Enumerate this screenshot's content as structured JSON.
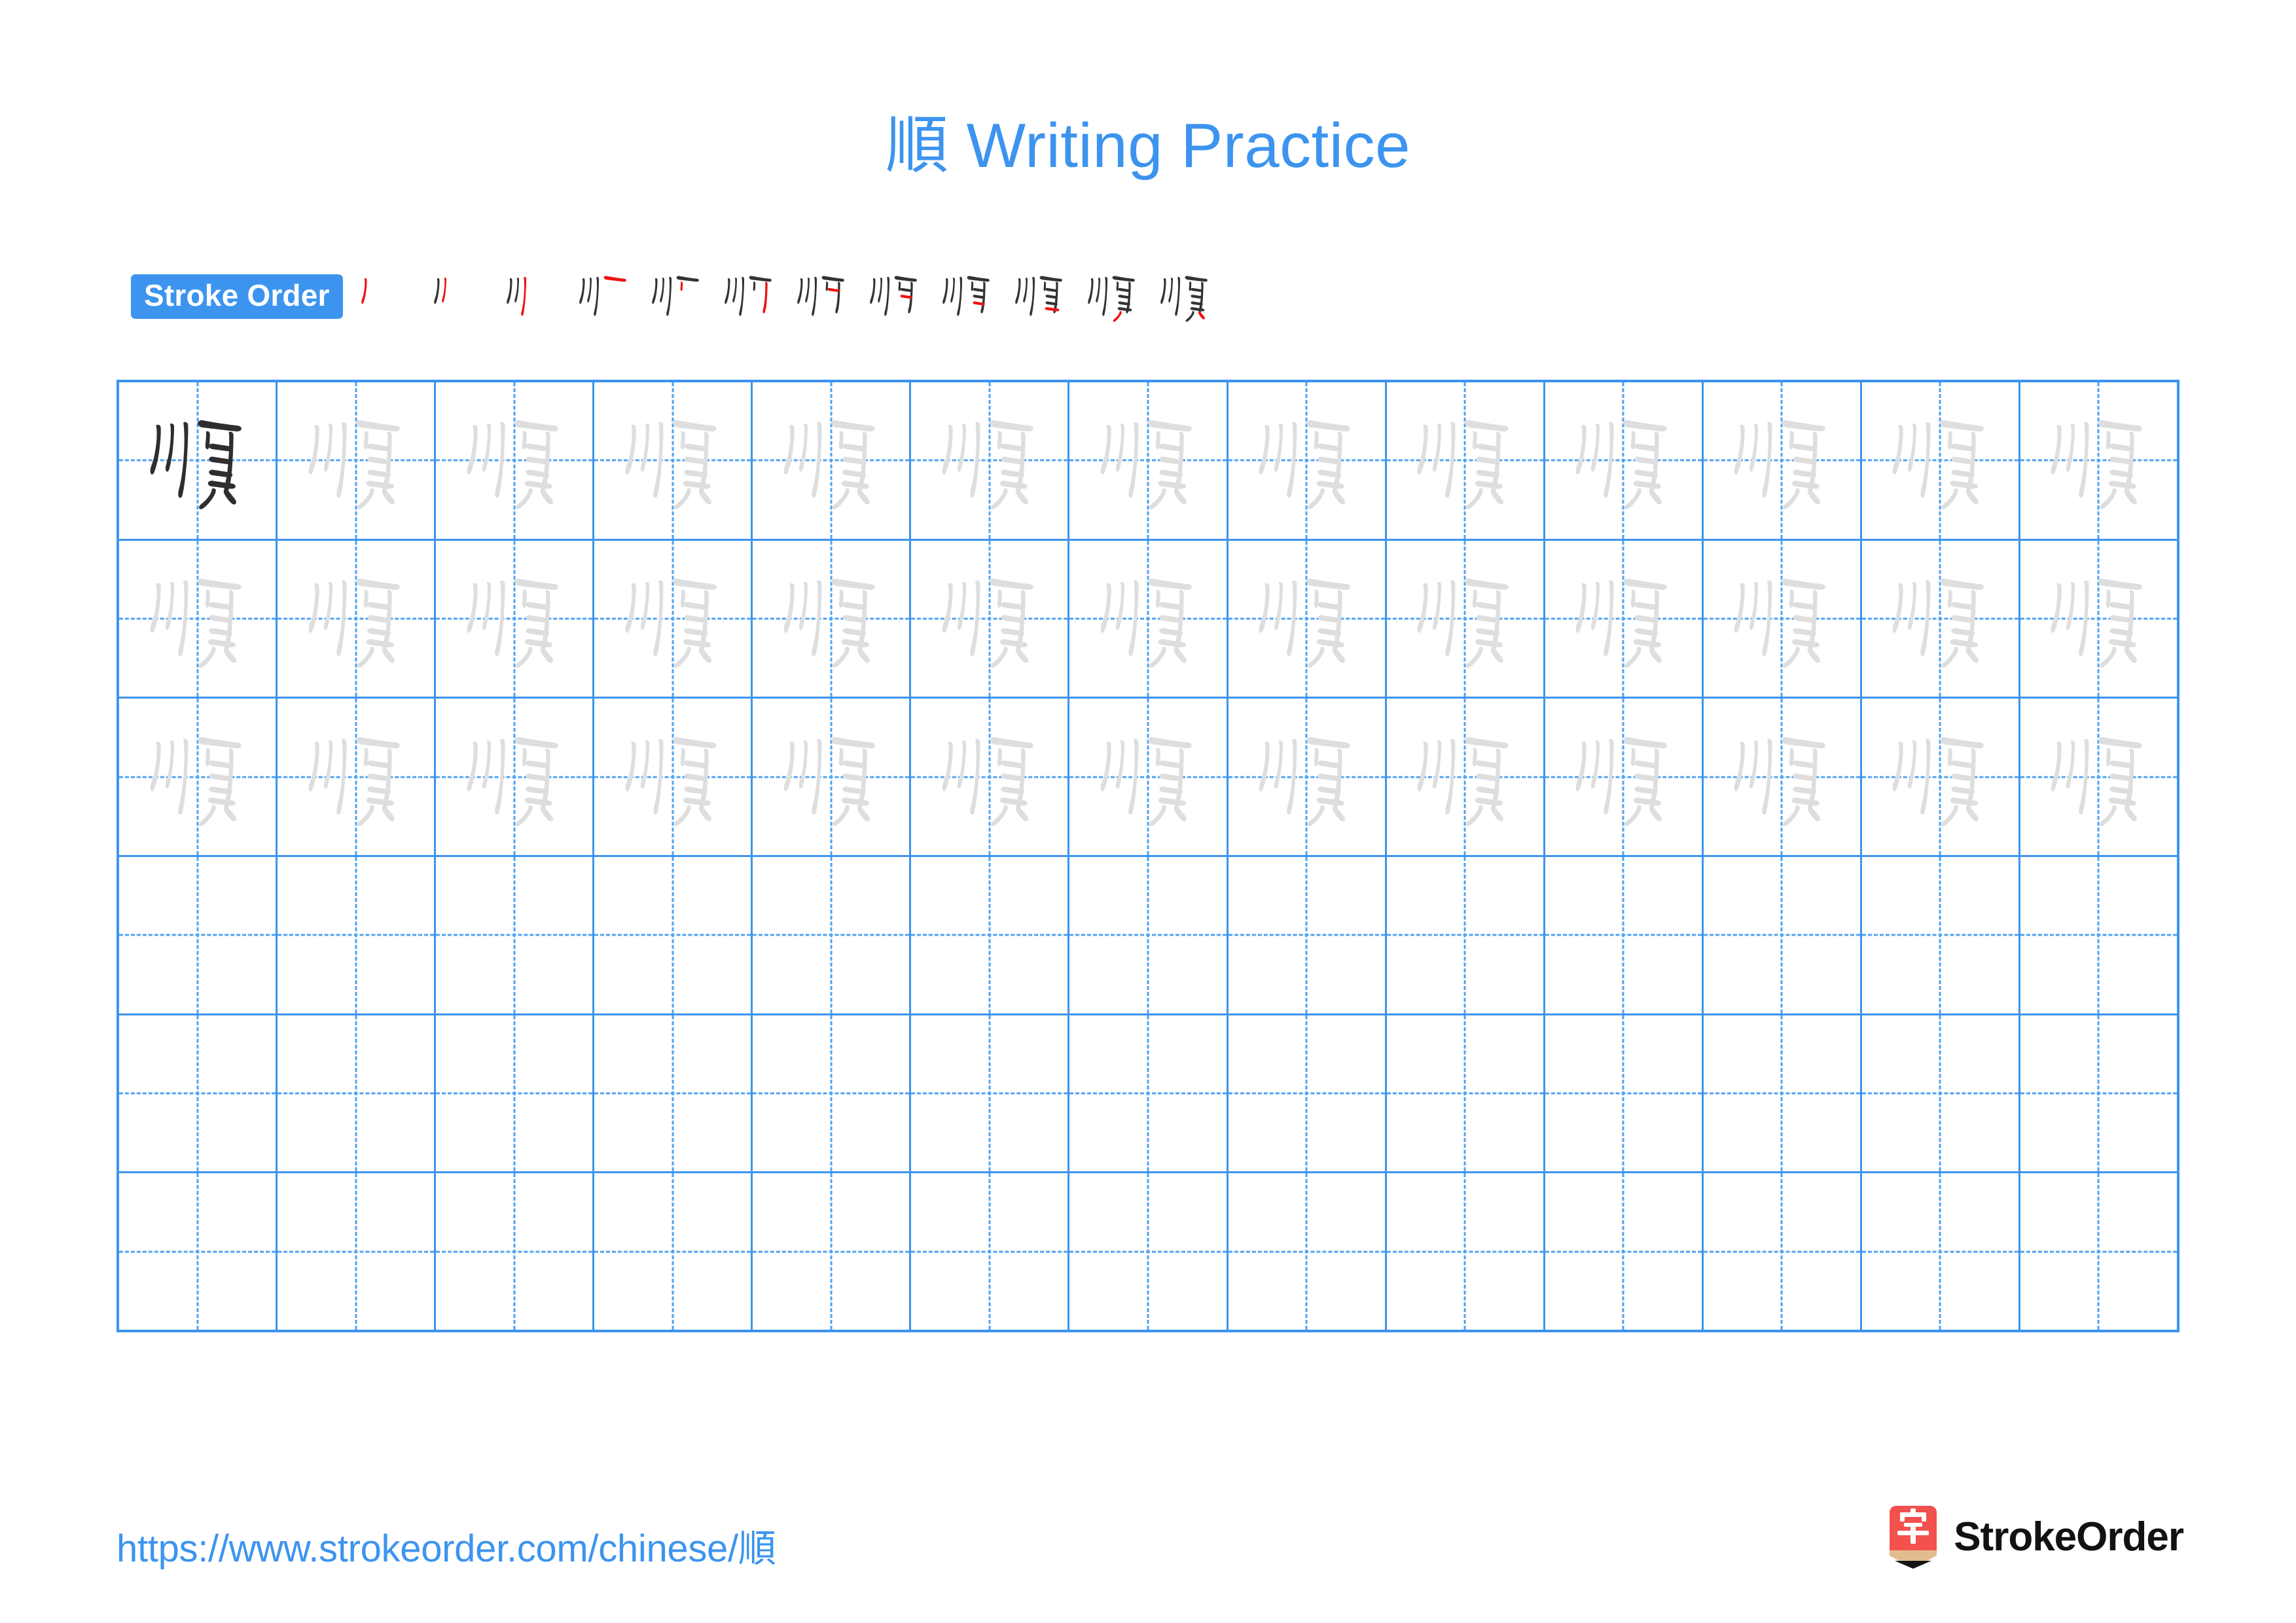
{
  "page": {
    "title": "順 Writing Practice",
    "character": "順",
    "character_color_dark": "#2e2e2e",
    "character_color_light": "#dedede",
    "accent_color": "#3c94ef",
    "stroke_highlight_color": "#ee1111",
    "grid_line_color": "#3c94ef",
    "grid_guide_color": "#4fa3f2"
  },
  "stroke_order": {
    "badge_label": "Stroke Order",
    "stroke_count": 12,
    "steps": [
      {
        "index": 1,
        "strokes_drawn": 1,
        "new_stroke": 1
      },
      {
        "index": 2,
        "strokes_drawn": 2,
        "new_stroke": 2
      },
      {
        "index": 3,
        "strokes_drawn": 3,
        "new_stroke": 3
      },
      {
        "index": 4,
        "strokes_drawn": 4,
        "new_stroke": 4
      },
      {
        "index": 5,
        "strokes_drawn": 5,
        "new_stroke": 5
      },
      {
        "index": 6,
        "strokes_drawn": 6,
        "new_stroke": 6
      },
      {
        "index": 7,
        "strokes_drawn": 7,
        "new_stroke": 7
      },
      {
        "index": 8,
        "strokes_drawn": 8,
        "new_stroke": 8
      },
      {
        "index": 9,
        "strokes_drawn": 9,
        "new_stroke": 9
      },
      {
        "index": 10,
        "strokes_drawn": 10,
        "new_stroke": 10
      },
      {
        "index": 11,
        "strokes_drawn": 11,
        "new_stroke": 11
      },
      {
        "index": 12,
        "strokes_drawn": 12,
        "new_stroke": 12
      }
    ]
  },
  "practice_grid": {
    "columns": 13,
    "rows": 6,
    "rows_data": [
      {
        "row": 1,
        "cells": [
          "dark",
          "light",
          "light",
          "light",
          "light",
          "light",
          "light",
          "light",
          "light",
          "light",
          "light",
          "light",
          "light"
        ]
      },
      {
        "row": 2,
        "cells": [
          "light",
          "light",
          "light",
          "light",
          "light",
          "light",
          "light",
          "light",
          "light",
          "light",
          "light",
          "light",
          "light"
        ]
      },
      {
        "row": 3,
        "cells": [
          "light",
          "light",
          "light",
          "light",
          "light",
          "light",
          "light",
          "light",
          "light",
          "light",
          "light",
          "light",
          "light"
        ]
      },
      {
        "row": 4,
        "cells": [
          "empty",
          "empty",
          "empty",
          "empty",
          "empty",
          "empty",
          "empty",
          "empty",
          "empty",
          "empty",
          "empty",
          "empty",
          "empty"
        ]
      },
      {
        "row": 5,
        "cells": [
          "empty",
          "empty",
          "empty",
          "empty",
          "empty",
          "empty",
          "empty",
          "empty",
          "empty",
          "empty",
          "empty",
          "empty",
          "empty"
        ]
      },
      {
        "row": 6,
        "cells": [
          "empty",
          "empty",
          "empty",
          "empty",
          "empty",
          "empty",
          "empty",
          "empty",
          "empty",
          "empty",
          "empty",
          "empty",
          "empty"
        ]
      }
    ]
  },
  "footer": {
    "url": "https://www.strokeorder.com/chinese/順",
    "logo_text": "StrokeOrder",
    "logo_glyph": "字",
    "logo_color": "#f2514e",
    "logo_pencil_color": "#e3bb90"
  }
}
